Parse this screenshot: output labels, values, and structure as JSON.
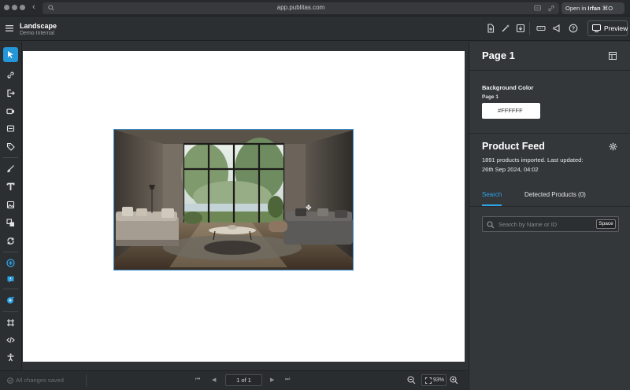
{
  "browser": {
    "url": "app.publitas.com",
    "open_in_prefix": "Open in",
    "open_in_app": "Irfan",
    "open_in_shortcut": "⌘O"
  },
  "app": {
    "title": "Landscape",
    "subtitle": "Demo Internal",
    "preview_label": "Preview"
  },
  "left_tools": [
    {
      "name": "select-tool",
      "icon": "cursor-icon"
    },
    {
      "name": "link-tool",
      "icon": "link-icon"
    },
    {
      "name": "external-link-tool",
      "icon": "exit-icon"
    },
    {
      "name": "video-tool",
      "icon": "video-icon"
    },
    {
      "name": "embed-tool",
      "icon": "embed-icon"
    },
    {
      "name": "product-tag-tool",
      "icon": "tag-icon"
    },
    {
      "name": "draw-tool",
      "icon": "brush-icon"
    },
    {
      "name": "text-tool",
      "icon": "text-icon"
    },
    {
      "name": "image-tool",
      "icon": "image-icon"
    },
    {
      "name": "layers-tool",
      "icon": "layers-icon"
    },
    {
      "name": "slideshow-tool",
      "icon": "refresh-icon"
    },
    {
      "name": "add-hotspot-tool",
      "icon": "plus-circle-icon"
    },
    {
      "name": "comment-tool",
      "icon": "comment-icon"
    },
    {
      "name": "ai-tool",
      "icon": "sparkle-icon"
    },
    {
      "name": "crop-tool",
      "icon": "frame-icon"
    },
    {
      "name": "code-tool",
      "icon": "code-icon"
    },
    {
      "name": "accessibility-tool",
      "icon": "person-icon"
    }
  ],
  "bottom": {
    "saved_status": "All changes saved",
    "page_indicator": "1 of 1",
    "zoom": "93%"
  },
  "right_panel": {
    "page_title": "Page 1",
    "background_label": "Background Color",
    "background_sublabel": "Page 1",
    "background_value": "#FFFFFF",
    "feed_title": "Product Feed",
    "feed_info_line1": "1891 products imported. Last updated:",
    "feed_info_line2": "26th Sep 2024, 04:02",
    "tabs": [
      "Search",
      "Detected Products (0)"
    ],
    "search_placeholder": "Search by Name or ID",
    "search_shortcut": "Space"
  },
  "colors": {
    "accent": "#2497d8",
    "panel_bg": "#33373a",
    "canvas_page": "#ffffff"
  }
}
